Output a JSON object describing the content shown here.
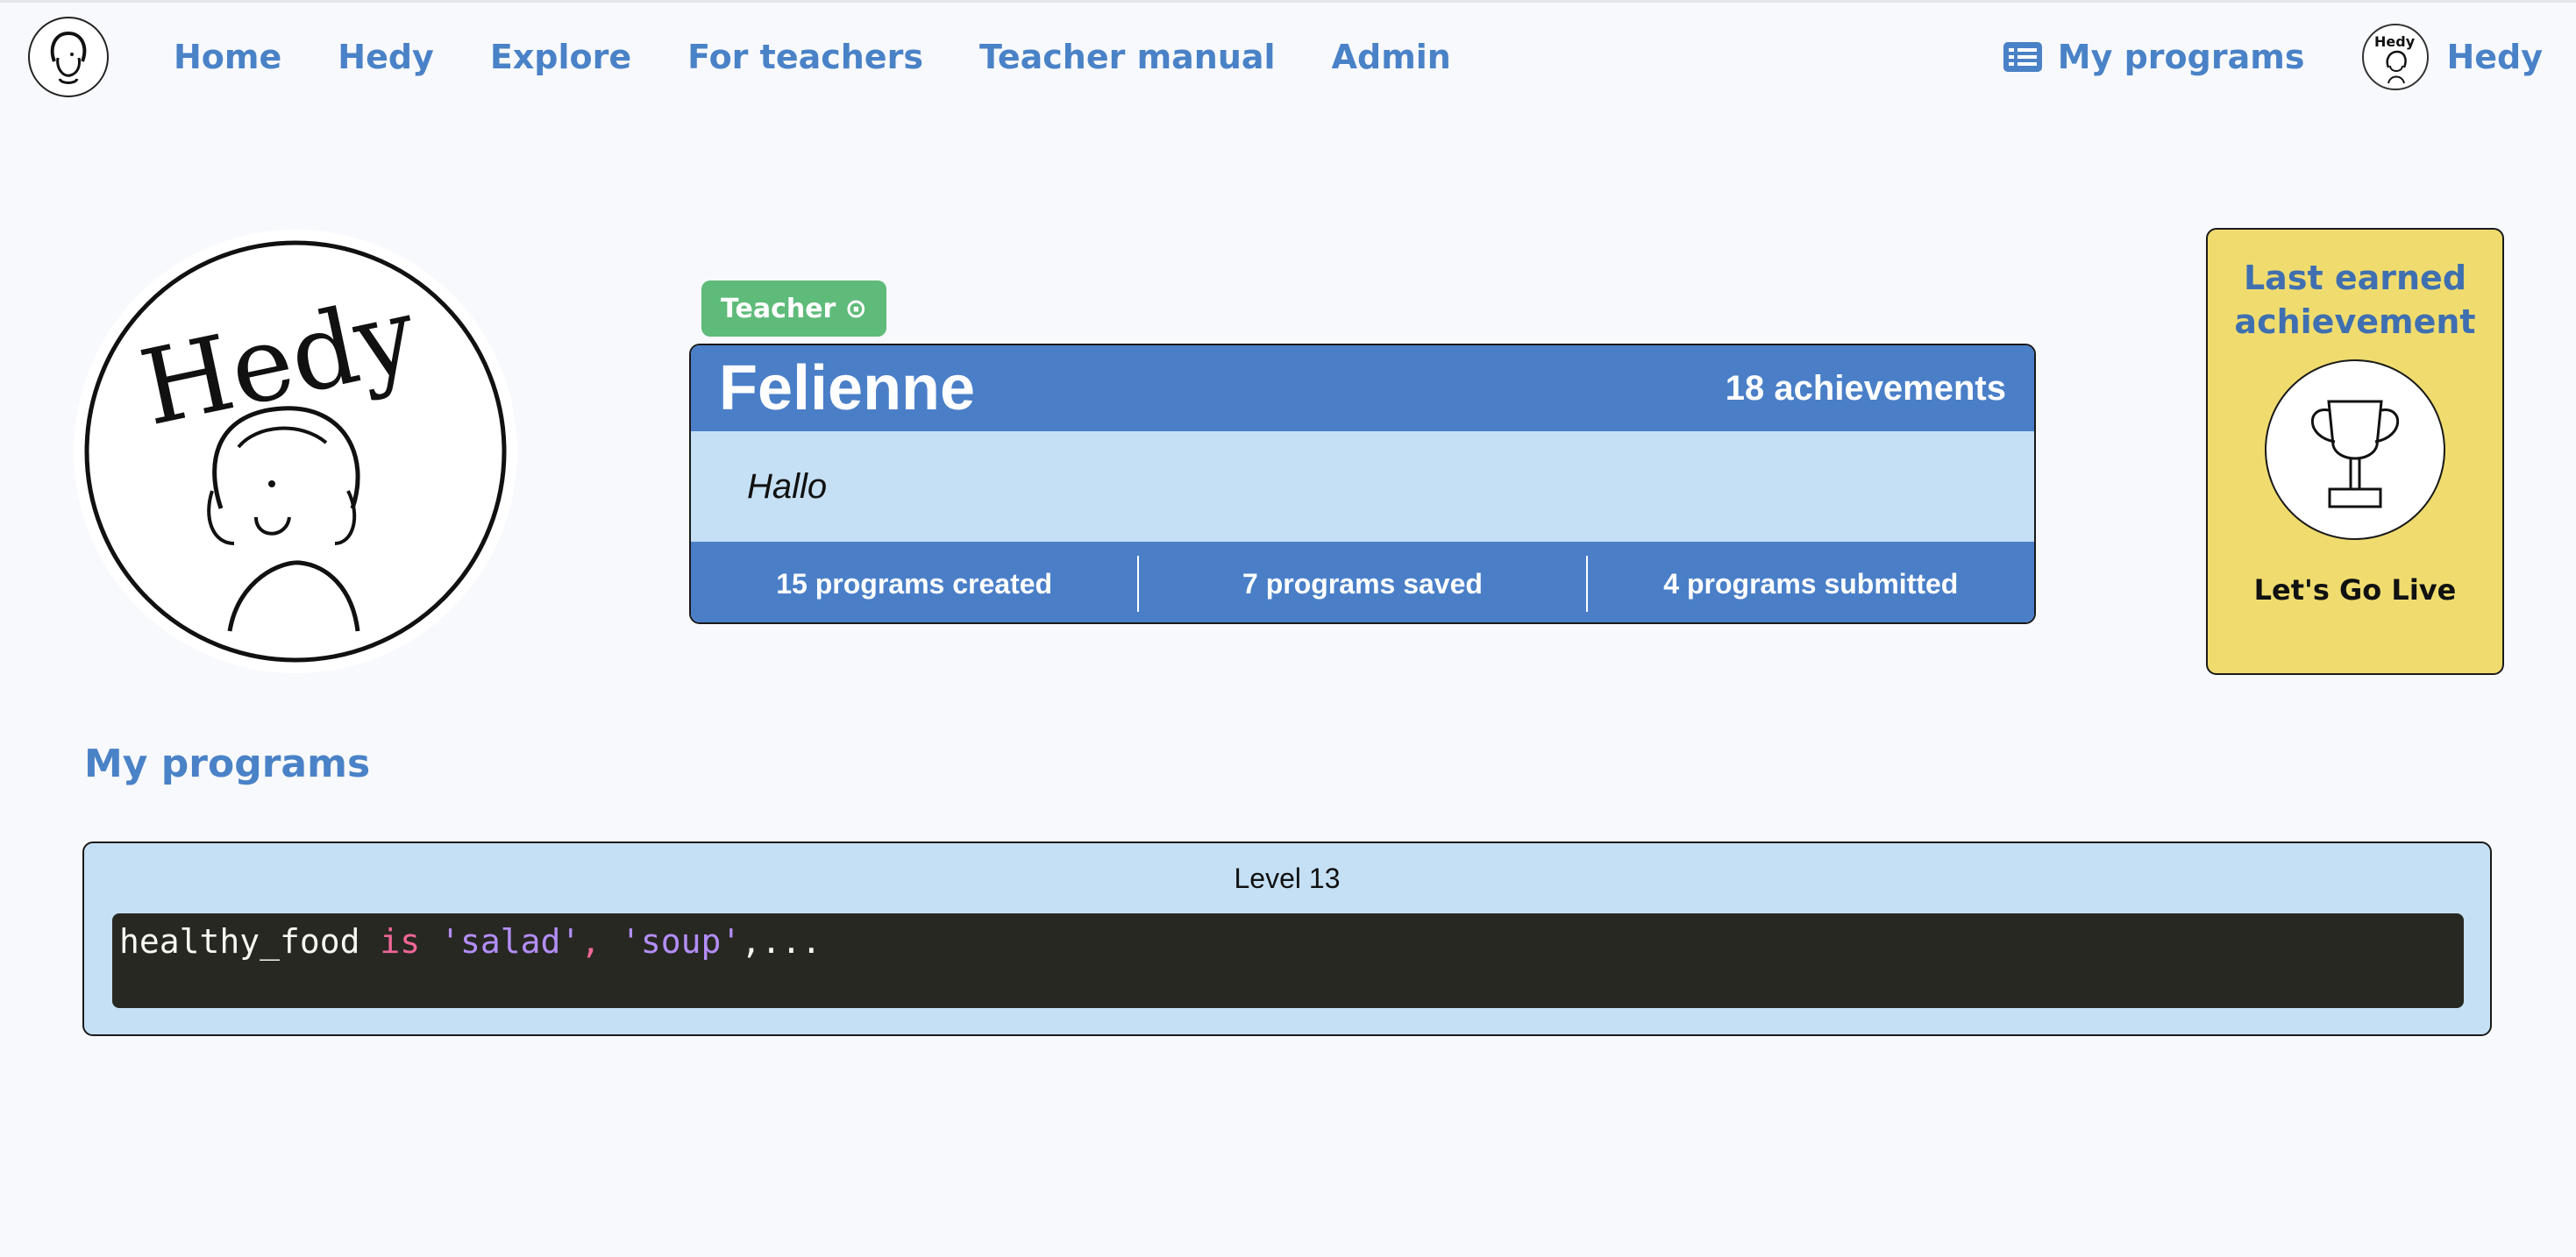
{
  "nav": {
    "links": [
      "Home",
      "Hedy",
      "Explore",
      "For teachers",
      "Teacher manual",
      "Admin"
    ],
    "my_programs": "My programs",
    "user": "Hedy",
    "avatar_text": "Hedy"
  },
  "profile": {
    "badge": "Teacher ⊙",
    "name": "Felienne",
    "achievements": "18 achievements",
    "bio": "Hallo",
    "stats": [
      "15 programs created",
      "7 programs saved",
      "4 programs submitted"
    ],
    "avatar_text": "Hedy"
  },
  "achievement": {
    "title": "Last earned achievement",
    "name": "Let's Go Live",
    "icon": "trophy-icon"
  },
  "programs": {
    "heading": "My programs",
    "items": [
      {
        "level": "Level 13",
        "code": {
          "var": "healthy_food ",
          "kw": "is",
          "sp": " ",
          "s1": "'salad'",
          "comma": ", ",
          "s2": "'soup'",
          "tail": ",..."
        }
      }
    ]
  },
  "colors": {
    "accent": "#4a82c7",
    "card_header": "#4a7fc8",
    "card_body": "#c5e0f5",
    "teacher_badge": "#5fbb7a",
    "achievement_bg": "#f0dc6e",
    "code_bg": "#272822"
  }
}
